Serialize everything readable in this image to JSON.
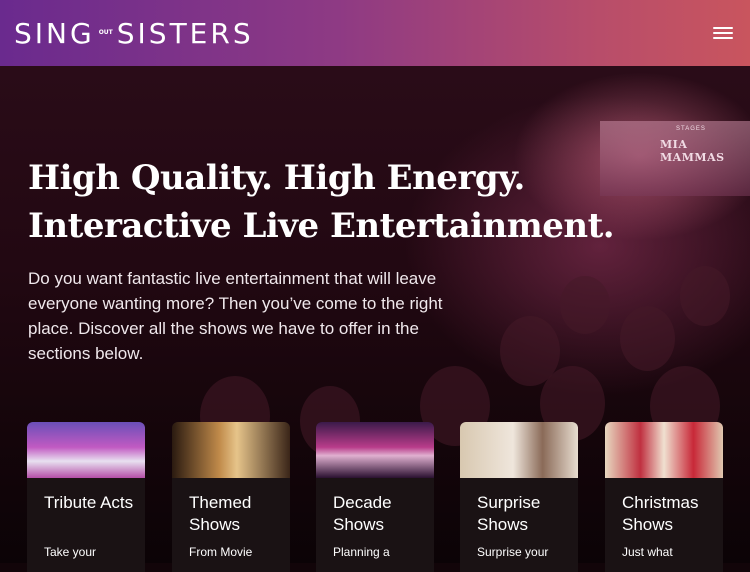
{
  "header": {
    "logo_left": "SING",
    "logo_small_top": "OUT",
    "logo_small_bottom": "OUT",
    "logo_right": "SISTERS",
    "menu_icon": "hamburger-menu-icon"
  },
  "hero": {
    "headline_line1": "High Quality. High Energy.",
    "headline_line2": "Interactive Live Entertainment.",
    "intro": "Do you want fantastic live entertainment that will leave everyone wanting more? Then you’ve come to the right place. Discover all the shows we have to offer in the sections below.",
    "stage_sign": "MIA MAMMAS",
    "stage_sub": "STAGES"
  },
  "cards": [
    {
      "title": "Tribute Acts",
      "desc": "Take your"
    },
    {
      "title": "Themed Shows",
      "desc": "From Movie"
    },
    {
      "title": "Decade Shows",
      "desc": "Planning a"
    },
    {
      "title": "Surprise Shows",
      "desc": "Surprise your"
    },
    {
      "title": "Christmas Shows",
      "desc": "Just what"
    }
  ],
  "colors": {
    "header_start": "#6a2a8e",
    "header_end": "#c9555e",
    "card_bg": "#1a1214"
  }
}
